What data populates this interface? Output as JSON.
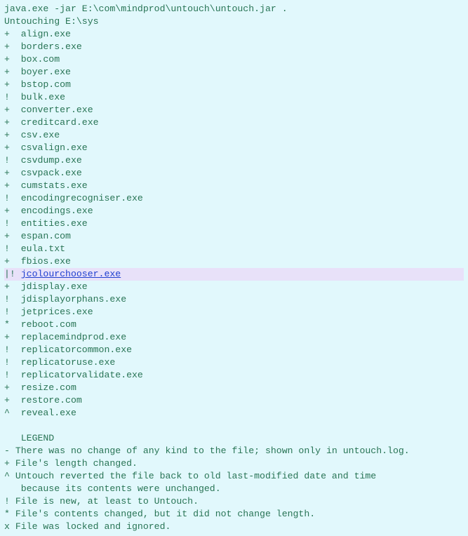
{
  "cmd": "java.exe -jar E:\\com\\mindprod\\untouch\\untouch.jar .",
  "running": "Untouching E:\\sys",
  "files": [
    {
      "sym": "+",
      "name": "align.exe"
    },
    {
      "sym": "+",
      "name": "borders.exe"
    },
    {
      "sym": "+",
      "name": "box.com"
    },
    {
      "sym": "+",
      "name": "boyer.exe"
    },
    {
      "sym": "+",
      "name": "bstop.com"
    },
    {
      "sym": "!",
      "name": "bulk.exe"
    },
    {
      "sym": "+",
      "name": "converter.exe"
    },
    {
      "sym": "+",
      "name": "creditcard.exe"
    },
    {
      "sym": "+",
      "name": "csv.exe"
    },
    {
      "sym": "+",
      "name": "csvalign.exe"
    },
    {
      "sym": "!",
      "name": "csvdump.exe"
    },
    {
      "sym": "+",
      "name": "csvpack.exe"
    },
    {
      "sym": "+",
      "name": "cumstats.exe"
    },
    {
      "sym": "!",
      "name": "encodingrecogniser.exe"
    },
    {
      "sym": "+",
      "name": "encodings.exe"
    },
    {
      "sym": "!",
      "name": "entities.exe"
    },
    {
      "sym": "+",
      "name": "espan.com"
    },
    {
      "sym": "!",
      "name": "eula.txt"
    },
    {
      "sym": "+",
      "name": "fbios.exe"
    },
    {
      "sym": "|!",
      "name": "jcolourchooser.exe",
      "highlight": true,
      "link": true
    },
    {
      "sym": "+",
      "name": "jdisplay.exe"
    },
    {
      "sym": "!",
      "name": "jdisplayorphans.exe"
    },
    {
      "sym": "!",
      "name": "jetprices.exe"
    },
    {
      "sym": "*",
      "name": "reboot.com"
    },
    {
      "sym": "+",
      "name": "replacemindprod.exe"
    },
    {
      "sym": "!",
      "name": "replicatorcommon.exe"
    },
    {
      "sym": "!",
      "name": "replicatoruse.exe"
    },
    {
      "sym": "!",
      "name": "replicatorvalidate.exe"
    },
    {
      "sym": "+",
      "name": "resize.com"
    },
    {
      "sym": "+",
      "name": "restore.com"
    },
    {
      "sym": "^",
      "name": "reveal.exe"
    }
  ],
  "legend_title": "   LEGEND",
  "legend": [
    {
      "sym": "-",
      "text": "There was no change of any kind to the file; shown only in untouch.log."
    },
    {
      "sym": "+",
      "text": "File's length changed."
    },
    {
      "sym": "^",
      "text": "Untouch reverted the file back to old last-modified date and time"
    },
    {
      "sym": " ",
      "text": " because its contents were unchanged."
    },
    {
      "sym": "!",
      "text": "File is new, at least to Untouch."
    },
    {
      "sym": "*",
      "text": "File's contents changed, but it did not change length."
    },
    {
      "sym": "x",
      "text": "File was locked and ignored."
    }
  ]
}
